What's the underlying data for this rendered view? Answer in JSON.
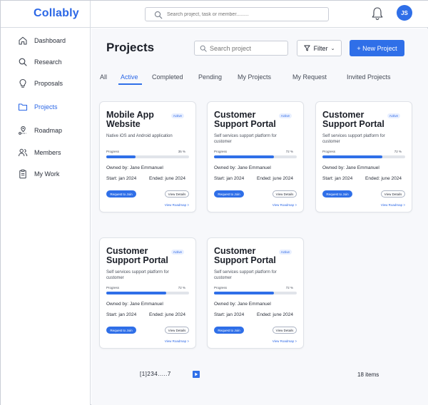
{
  "app": {
    "logo": "Collably"
  },
  "header": {
    "search_placeholder": "Search project, task or member.........",
    "avatar_initials": "JS"
  },
  "sidebar": {
    "items": [
      {
        "label": "Dashboard",
        "icon": "home-icon"
      },
      {
        "label": "Research",
        "icon": "search-icon"
      },
      {
        "label": "Proposals",
        "icon": "lightbulb-icon"
      },
      {
        "label": "Projects",
        "icon": "folder-icon",
        "active": true
      },
      {
        "label": "Roadmap",
        "icon": "map-pin-icon"
      },
      {
        "label": "Members",
        "icon": "users-icon"
      },
      {
        "label": "My Work",
        "icon": "clipboard-icon"
      }
    ]
  },
  "main": {
    "title": "Projects",
    "search_placeholder": "Search project",
    "filter_label": "Filter",
    "filter_chevron": "⌄",
    "new_project_label": "+ New Project",
    "tabs": [
      "All",
      "Active",
      "Completed",
      "Pending",
      "My Projects",
      "My Request",
      "Invited Projects"
    ],
    "active_tab": "Active",
    "cards": [
      {
        "title": "Mobile App Website",
        "badge": "Active",
        "desc": "Native iOS and Android application",
        "progress_label": "Progress",
        "progress_pct": "35 %",
        "progress": 0.35,
        "owner": "Owned by: Jane Emmanuel",
        "start": "Start: jan 2024",
        "ended": "Ended: june 2024",
        "join_label": "Request to Join",
        "details_label": "View Details",
        "roadmap_label": "View Roadmap >"
      },
      {
        "title": "Customer Support Portal",
        "badge": "Active",
        "desc": "Self services support platform for customer",
        "progress_label": "Progress",
        "progress_pct": "72 %",
        "progress": 0.72,
        "owner": "Owned by: Jane Emmanuel",
        "start": "Start: jan 2024",
        "ended": "Ended: june 2024",
        "join_label": "Request to Join",
        "details_label": "View Details",
        "roadmap_label": "View Roadmap >"
      },
      {
        "title": "Customer Support Portal",
        "badge": "Active",
        "desc": "Self services support platform for customer",
        "progress_label": "Progress",
        "progress_pct": "72 %",
        "progress": 0.72,
        "owner": "Owned by: Jane Emmanuel",
        "start": "Start: jan 2024",
        "ended": "Ended: june 2024",
        "join_label": "Request to Join",
        "details_label": "View Details",
        "roadmap_label": "View Roadmap >"
      },
      {
        "title": "Customer Support Portal",
        "badge": "Active",
        "desc": "Self services support platform for customer",
        "progress_label": "Progress",
        "progress_pct": "72 %",
        "progress": 0.72,
        "owner": "Owned by: Jane Emmanuel",
        "start": "Start: jan 2024",
        "ended": "Ended: june 2024",
        "join_label": "Request to Join",
        "details_label": "View Details",
        "roadmap_label": "View Roadmap >"
      },
      {
        "title": "Customer Support Portal",
        "badge": "Active",
        "desc": "Self services support platform for customer",
        "progress_label": "Progress",
        "progress_pct": "72 %",
        "progress": 0.72,
        "owner": "Owned by: Jane Emmanuel",
        "start": "Start: jan 2024",
        "ended": "Ended: june 2024",
        "join_label": "Request to Join",
        "details_label": "View Details",
        "roadmap_label": "View Roadmap >"
      }
    ],
    "pagination": "[1]234.....7",
    "items_count": "18 items"
  },
  "colors": {
    "accent": "#2f6fe8",
    "logo": "#2b67e6",
    "track": "#e1e4ea"
  }
}
